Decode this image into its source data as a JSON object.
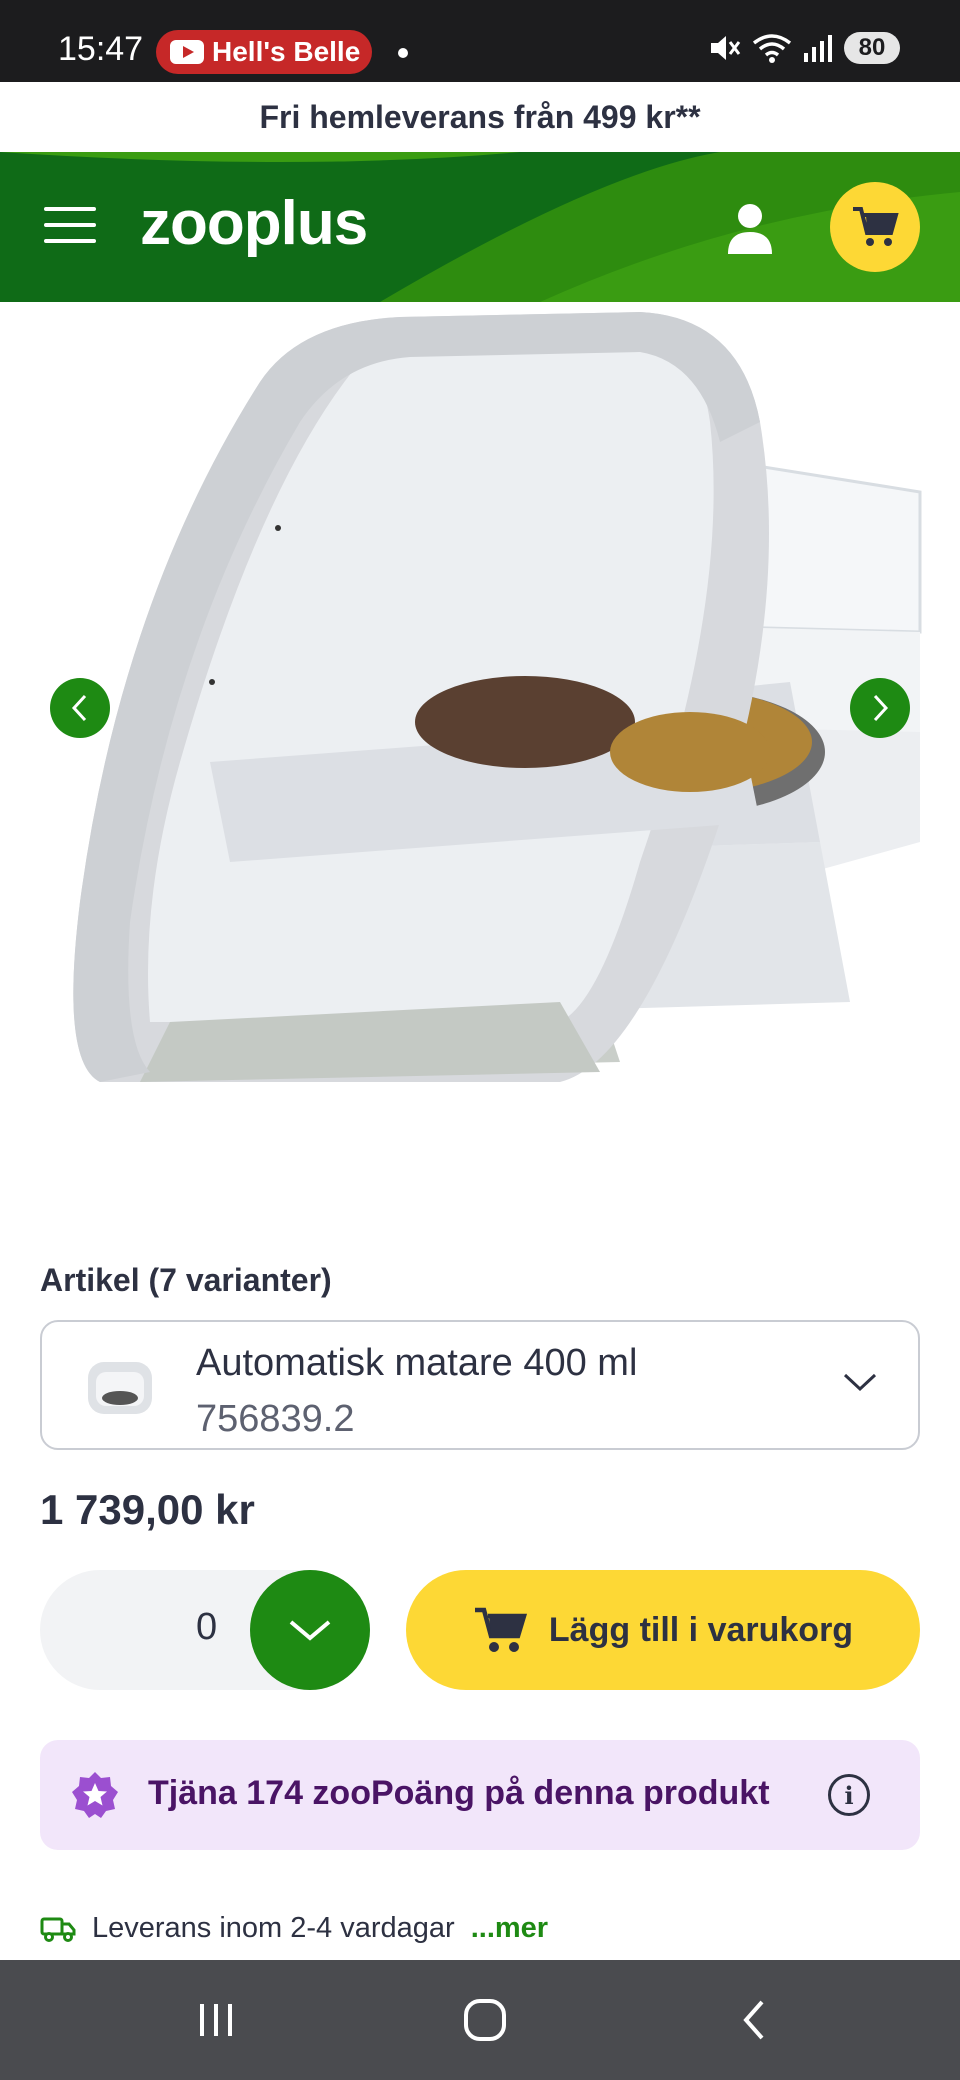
{
  "status_bar": {
    "time": "15:47",
    "media_pill": "Hell's Belle",
    "battery": "80",
    "icons": [
      "mute-icon",
      "wifi-icon",
      "signal-icon",
      "battery-icon"
    ]
  },
  "promo_banner": "Fri hemleverans från 499 kr**",
  "header": {
    "logo": "zooplus",
    "menu_icon": "hamburger-menu-icon",
    "account_icon": "user-icon",
    "cart_icon": "cart-icon",
    "colors": {
      "header_green": "#0f6b17",
      "accent_yellow": "#fdd835",
      "button_green": "#1e8a13"
    }
  },
  "product": {
    "image": "automatic-pet-feeder-photo",
    "variant_label": "Artikel (7 varianter)",
    "variant_name": "Automatisk matare 400 ml",
    "variant_id": "756839.2",
    "price": "1 739,00 kr"
  },
  "purchase": {
    "quantity": "0",
    "add_to_cart": "Lägg till i varukorg"
  },
  "points": {
    "text": "Tjäna 174 zooPoäng på denna produkt",
    "color": "#f2e6fa"
  },
  "delivery": {
    "text": "Leverans inom 2-4 vardagar",
    "more": "...mer"
  },
  "nav_bar": {
    "buttons": [
      "recent-apps-icon",
      "home-icon",
      "back-icon"
    ]
  }
}
